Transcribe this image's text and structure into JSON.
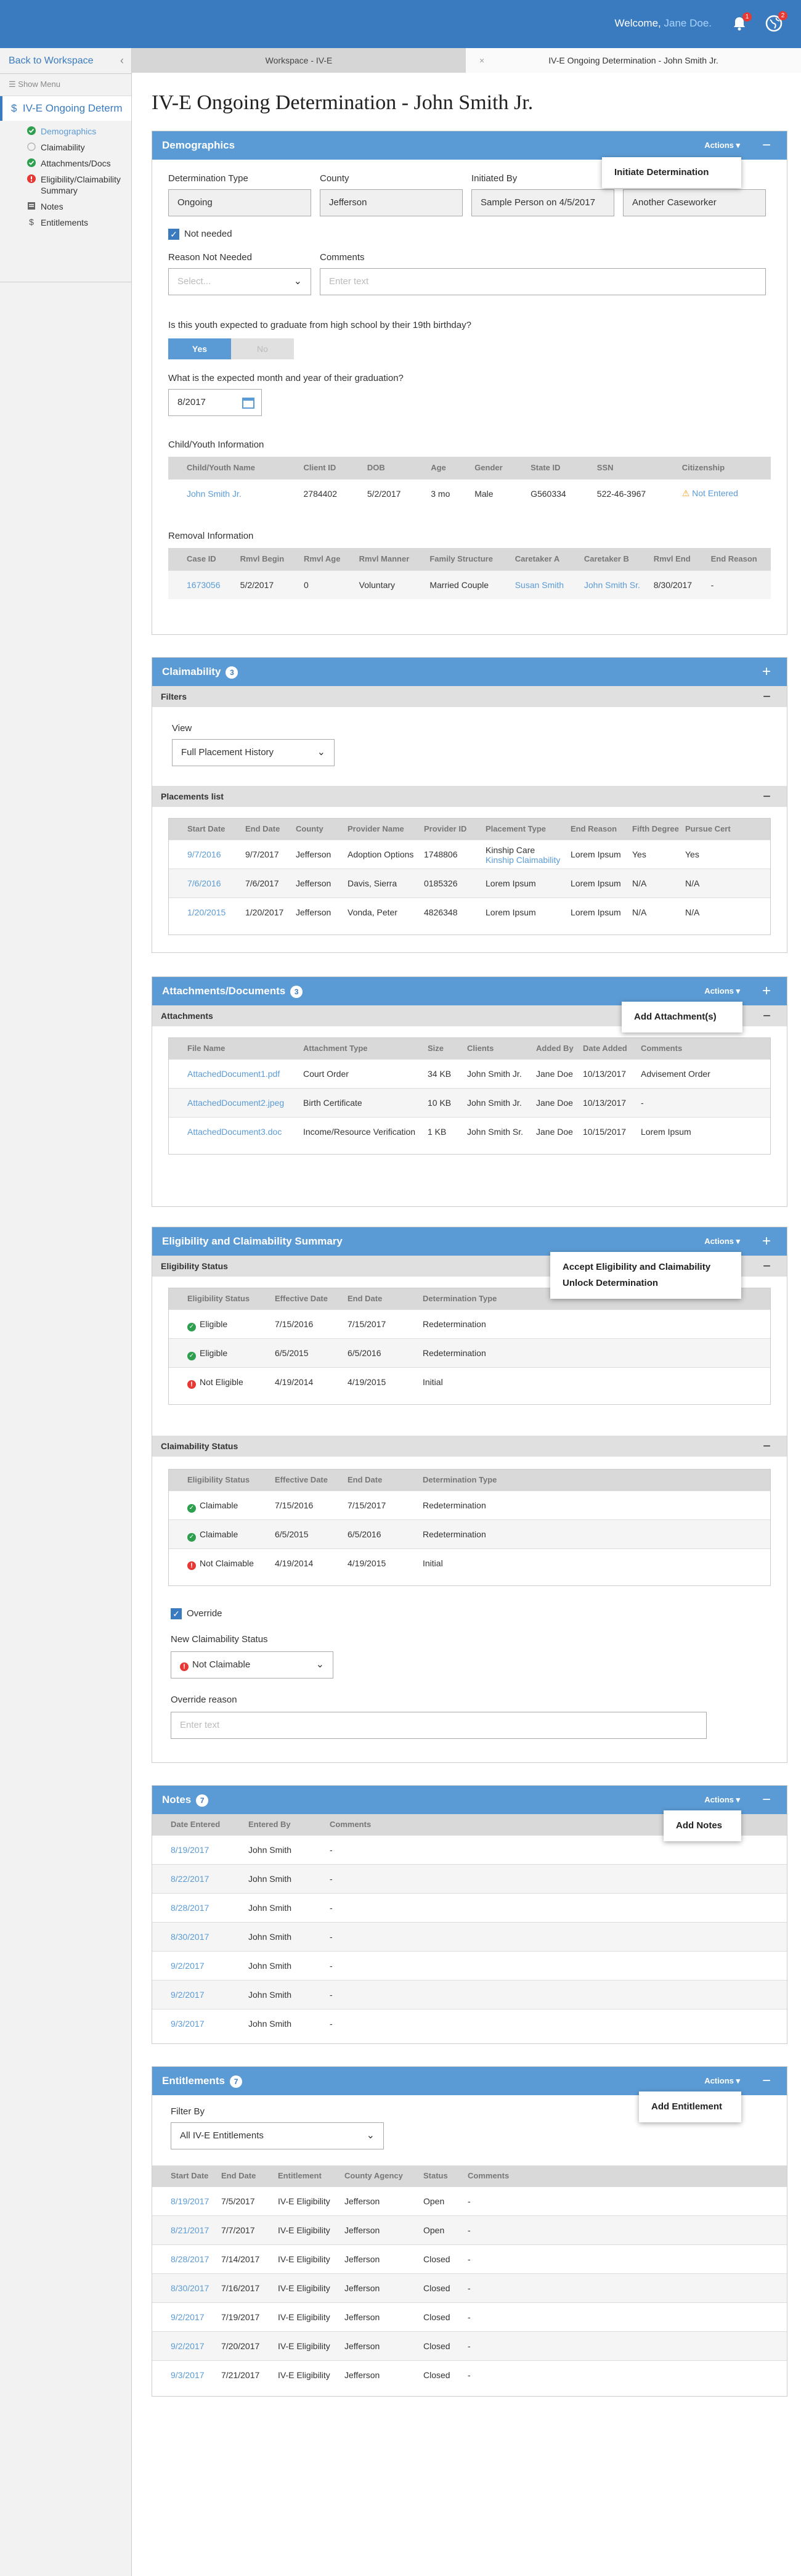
{
  "header": {
    "welcome_prefix": "Welcome,",
    "user": "Jane Doe.",
    "notif_count": "1",
    "alerts_count": "2"
  },
  "sidebar": {
    "back": "Back to Workspace",
    "show_menu": "Show Menu",
    "title": "IV-E Ongoing Determ",
    "items": [
      {
        "label": "Demographics",
        "status": "done",
        "active": true
      },
      {
        "label": "Claimability",
        "status": "empty"
      },
      {
        "label": "Attachments/Docs",
        "status": "done"
      },
      {
        "label": "Eligibility/Claimability Summary",
        "status": "error"
      },
      {
        "label": "Notes",
        "status": "notes"
      },
      {
        "label": "Entitlements",
        "status": "dollar"
      }
    ]
  },
  "tabs": [
    {
      "label": "Workspace - IV-E"
    },
    {
      "label": "IV-E Ongoing Determination - John Smith Jr."
    }
  ],
  "page_title": "IV-E Ongoing Determination - John Smith Jr.",
  "demographics": {
    "title": "Demographics",
    "actions": "Actions ▾",
    "popup": "Initiate Determination",
    "labels": {
      "type": "Determination Type",
      "county": "County",
      "initiated": "Initiated By",
      "reason": "Reason Not Needed",
      "comments": "Comments"
    },
    "values": {
      "type": "Ongoing",
      "county": "Jefferson",
      "initiated": "Sample Person on 4/5/2017",
      "worker": "Another Caseworker"
    },
    "not_needed": "Not needed",
    "reason_placeholder": "Select...",
    "comments_placeholder": "Enter text",
    "graduate_q": "Is this youth expected to graduate from high school by their 19th birthday?",
    "yes": "Yes",
    "no": "No",
    "grad_date_q": "What is the expected month and year of their graduation?",
    "grad_date": "8/2017",
    "child_info_title": "Child/Youth Information",
    "child_cols": [
      "Child/Youth Name",
      "Client ID",
      "DOB",
      "Age",
      "Gender",
      "State ID",
      "SSN",
      "Citizenship"
    ],
    "child_row": {
      "name": "John Smith Jr.",
      "client_id": "2784402",
      "dob": "5/2/2017",
      "age": "3 mo",
      "gender": "Male",
      "state_id": "G560334",
      "ssn": "522-46-3967",
      "citizenship": "Not Entered"
    },
    "removal_title": "Removal Information",
    "removal_cols": [
      "Case ID",
      "Rmvl Begin",
      "Rmvl Age",
      "Rmvl Manner",
      "Family Structure",
      "Caretaker A",
      "Caretaker B",
      "Rmvl End",
      "End Reason"
    ],
    "removal_row": {
      "case_id": "1673056",
      "begin": "5/2/2017",
      "age": "0",
      "manner": "Voluntary",
      "family": "Married Couple",
      "ca": "Susan Smith",
      "cb": "John Smith Sr.",
      "end": "8/30/2017",
      "reason": "-"
    }
  },
  "claimability": {
    "title": "Claimability",
    "count": "3",
    "filters": "Filters",
    "view_label": "View",
    "view_value": "Full Placement History",
    "placements": "Placements list",
    "cols": [
      "Start Date",
      "End Date",
      "County",
      "Provider Name",
      "Provider ID",
      "Placement Type",
      "End Reason",
      "Fifth Degree",
      "Pursue Cert"
    ],
    "rows": [
      {
        "start": "9/7/2016",
        "end": "9/7/2017",
        "county": "Jefferson",
        "provider": "Adoption Options",
        "pid": "1748806",
        "type": "Kinship Care",
        "type2": "Kinship Claimability",
        "reason": "Lorem Ipsum",
        "fifth": "Yes",
        "cert": "Yes"
      },
      {
        "start": "7/6/2016",
        "end": "7/6/2017",
        "county": "Jefferson",
        "provider": "Davis, Sierra",
        "pid": "0185326",
        "type": "Lorem Ipsum",
        "type2": "",
        "reason": "Lorem Ipsum",
        "fifth": "N/A",
        "cert": "N/A"
      },
      {
        "start": "1/20/2015",
        "end": "1/20/2017",
        "county": "Jefferson",
        "provider": "Vonda, Peter",
        "pid": "4826348",
        "type": "Lorem Ipsum",
        "type2": "",
        "reason": "Lorem Ipsum",
        "fifth": "N/A",
        "cert": "N/A"
      }
    ]
  },
  "attachments": {
    "title": "Attachments/Documents",
    "count": "3",
    "actions": "Actions ▾",
    "popup": "Add Attachment(s)",
    "sub": "Attachments",
    "cols": [
      "File Name",
      "Attachment Type",
      "Size",
      "Clients",
      "Added By",
      "Date Added",
      "Comments"
    ],
    "rows": [
      {
        "file": "AttachedDocument1.pdf",
        "type": "Court Order",
        "size": "34 KB",
        "client": "John Smith Jr.",
        "by": "Jane Doe",
        "date": "10/13/2017",
        "comment": "Advisement Order"
      },
      {
        "file": "AttachedDocument2.jpeg",
        "type": "Birth Certificate",
        "size": "10 KB",
        "client": "John Smith Jr.",
        "by": "Jane Doe",
        "date": "10/13/2017",
        "comment": "-"
      },
      {
        "file": "AttachedDocument3.doc",
        "type": "Income/Resource Verification",
        "size": "1 KB",
        "client": "John Smith Sr.",
        "by": "Jane Doe",
        "date": "10/15/2017",
        "comment": "Lorem Ipsum"
      }
    ]
  },
  "summary": {
    "title": "Eligibility and Claimability Summary",
    "actions": "Actions ▾",
    "popup1": "Accept Eligibility and Claimability",
    "popup2": "Unlock Determination",
    "elig_sub": "Eligibility Status",
    "elig_cols": [
      "Eligibility Status",
      "Effective Date",
      "End Date",
      "Determination Type"
    ],
    "elig_rows": [
      {
        "status": "Eligible",
        "ok": true,
        "eff": "7/15/2016",
        "end": "7/15/2017",
        "type": "Redetermination"
      },
      {
        "status": "Eligible",
        "ok": true,
        "eff": "6/5/2015",
        "end": "6/5/2016",
        "type": "Redetermination"
      },
      {
        "status": "Not Eligible",
        "ok": false,
        "eff": "4/19/2014",
        "end": "4/19/2015",
        "type": "Initial"
      }
    ],
    "claim_sub": "Claimability Status",
    "claim_cols": [
      "Eligibility Status",
      "Effective Date",
      "End Date",
      "Determination Type"
    ],
    "claim_rows": [
      {
        "status": "Claimable",
        "ok": true,
        "eff": "7/15/2016",
        "end": "7/15/2017",
        "type": "Redetermination"
      },
      {
        "status": "Claimable",
        "ok": true,
        "eff": "6/5/2015",
        "end": "6/5/2016",
        "type": "Redetermination"
      },
      {
        "status": "Not Claimable",
        "ok": false,
        "eff": "4/19/2014",
        "end": "4/19/2015",
        "type": "Initial"
      }
    ],
    "override": "Override",
    "new_status_label": "New Claimability Status",
    "new_status": "Not Claimable",
    "override_reason": "Override reason",
    "override_placeholder": "Enter text"
  },
  "notes": {
    "title": "Notes",
    "count": "7",
    "actions": "Actions ▾",
    "popup": "Add Notes",
    "cols": [
      "Date Entered",
      "Entered By",
      "Comments"
    ],
    "rows": [
      {
        "date": "8/19/2017",
        "by": "John Smith",
        "comment": "-"
      },
      {
        "date": "8/22/2017",
        "by": "John Smith",
        "comment": "-"
      },
      {
        "date": "8/28/2017",
        "by": "John Smith",
        "comment": "-"
      },
      {
        "date": "8/30/2017",
        "by": "John Smith",
        "comment": "-"
      },
      {
        "date": "9/2/2017",
        "by": "John Smith",
        "comment": "-"
      },
      {
        "date": "9/2/2017",
        "by": "John Smith",
        "comment": "-"
      },
      {
        "date": "9/3/2017",
        "by": "John Smith",
        "comment": "-"
      }
    ]
  },
  "entitlements": {
    "title": "Entitlements",
    "count": "7",
    "actions": "Actions ▾",
    "popup": "Add Entitlement",
    "filter_label": "Filter By",
    "filter_value": "All IV-E Entitlements",
    "cols": [
      "Start Date",
      "End Date",
      "Entitlement",
      "County Agency",
      "Status",
      "Comments"
    ],
    "rows": [
      {
        "start": "8/19/2017",
        "end": "7/5/2017",
        "ent": "IV-E Eligibility",
        "county": "Jefferson",
        "status": "Open",
        "comment": "-"
      },
      {
        "start": "8/21/2017",
        "end": "7/7/2017",
        "ent": "IV-E Eligibility",
        "county": "Jefferson",
        "status": "Open",
        "comment": "-"
      },
      {
        "start": "8/28/2017",
        "end": "7/14/2017",
        "ent": "IV-E Eligibility",
        "county": "Jefferson",
        "status": "Closed",
        "comment": "-"
      },
      {
        "start": "8/30/2017",
        "end": "7/16/2017",
        "ent": "IV-E Eligibility",
        "county": "Jefferson",
        "status": "Closed",
        "comment": "-"
      },
      {
        "start": "9/2/2017",
        "end": "7/19/2017",
        "ent": "IV-E Eligibility",
        "county": "Jefferson",
        "status": "Closed",
        "comment": "-"
      },
      {
        "start": "9/2/2017",
        "end": "7/20/2017",
        "ent": "IV-E Eligibility",
        "county": "Jefferson",
        "status": "Closed",
        "comment": "-"
      },
      {
        "start": "9/3/2017",
        "end": "7/21/2017",
        "ent": "IV-E Eligibility",
        "county": "Jefferson",
        "status": "Closed",
        "comment": "-"
      }
    ]
  }
}
